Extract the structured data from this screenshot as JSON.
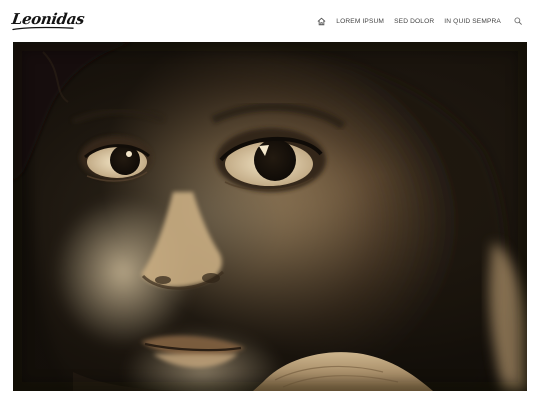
{
  "site": {
    "logo_text": "Leonidas"
  },
  "nav": {
    "home_icon": "home-icon",
    "items": [
      {
        "label": "LOREM IPSUM"
      },
      {
        "label": "SED DOLOR"
      },
      {
        "label": "IN QUID SEMPRA"
      }
    ],
    "search_icon": "search-icon"
  },
  "hero": {
    "subject": "sepia portrait photograph",
    "tone_colors": {
      "highlight": "#e6cfa6",
      "midtone": "#a98a62",
      "shadow": "#1a140d"
    }
  }
}
